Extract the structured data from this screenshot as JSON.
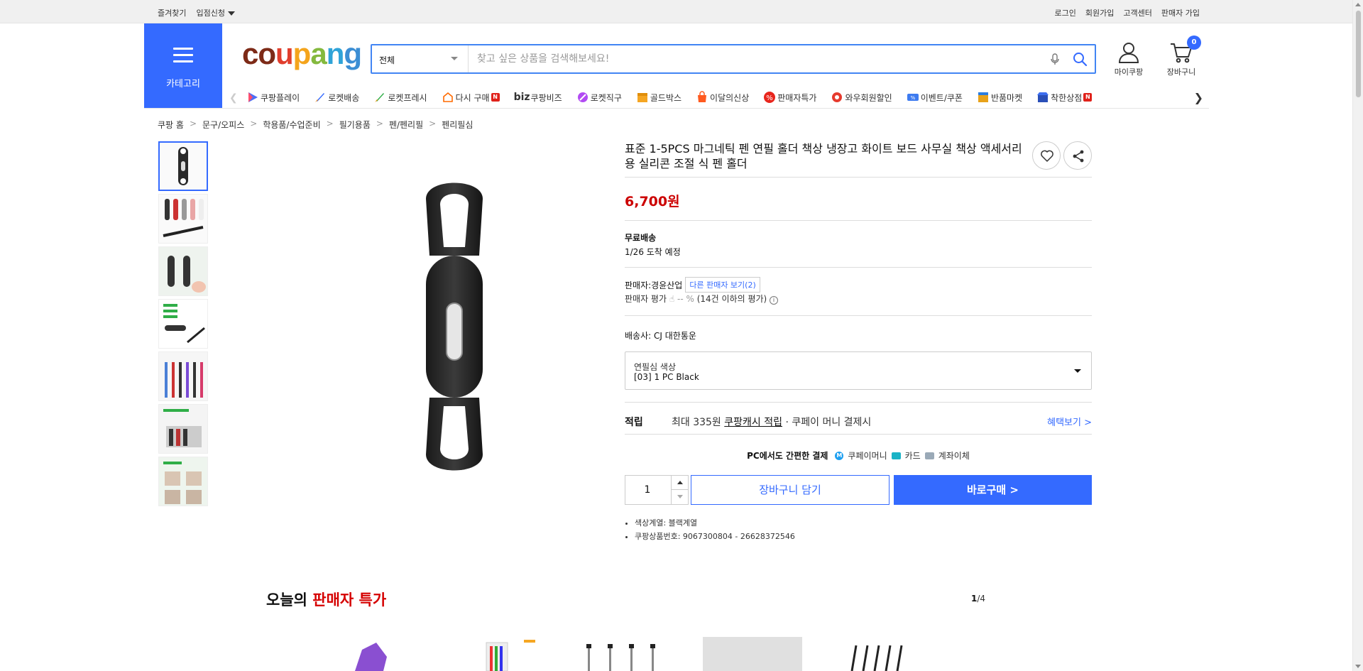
{
  "topbar": {
    "left": [
      "즐겨찾기",
      "입점신청"
    ],
    "right": [
      "로그인",
      "회원가입",
      "고객센터",
      "판매자 가입"
    ]
  },
  "header": {
    "category_label": "카테고리",
    "logo": [
      "c",
      "o",
      "u",
      "p",
      "a",
      "n",
      "g"
    ],
    "search_scope": "전체",
    "search_placeholder": "찾고 싶은 상품을 검색해보세요!",
    "my_label": "마이쿠팡",
    "cart_label": "장바구니",
    "cart_count": "0",
    "brand_color": "#346aff"
  },
  "nav": [
    {
      "label": "쿠팡플레이",
      "icon": "coupang-play-icon"
    },
    {
      "label": "로켓배송",
      "icon": "rocket-icon"
    },
    {
      "label": "로켓프레시",
      "icon": "rocket-fresh-icon"
    },
    {
      "label": "다시 구매",
      "icon": "reorder-icon",
      "badge": "N"
    },
    {
      "label": "쿠팡비즈",
      "icon": "biz-icon",
      "prefix": "biz"
    },
    {
      "label": "로켓직구",
      "icon": "rocket-global-icon"
    },
    {
      "label": "골드박스",
      "icon": "goldbox-icon"
    },
    {
      "label": "이달의신상",
      "icon": "new-arrival-icon"
    },
    {
      "label": "판매자특가",
      "icon": "seller-deal-icon"
    },
    {
      "label": "와우회원할인",
      "icon": "wow-icon"
    },
    {
      "label": "이벤트/쿠폰",
      "icon": "coupon-icon"
    },
    {
      "label": "반품마켓",
      "icon": "return-market-icon"
    },
    {
      "label": "착한상점",
      "icon": "good-shop-icon",
      "badge": "N"
    }
  ],
  "breadcrumb": [
    "쿠팡 홈",
    "문구/오피스",
    "학용품/수업준비",
    "필기용품",
    "펜/펜리필",
    "펜리필심"
  ],
  "product": {
    "title": "표준 1-5PCS 마그네틱 펜 연필 홀더 책상 냉장고 화이트 보드 사무실 책상 액세서리 용 실리콘 조절 식 펜 홀더",
    "price": "6,700원",
    "shipping_title": "무료배송",
    "shipping_eta": "1/26 도착 예정",
    "seller_label": "판매자:",
    "seller_name": "경윤산업",
    "other_sellers": "다른 판매자 보기(2)",
    "rating_label": "판매자 평가",
    "rating_value": "-- %",
    "rating_note": "(14건 이하의 평가)",
    "courier_label": "배송사:",
    "courier_name": "CJ 대한통운",
    "option_label": "연필심 색상",
    "option_value": "[03] 1 PC Black",
    "reward_label": "적립",
    "reward_prefix": "최대 335원",
    "reward_link": "쿠팡캐시 적립",
    "reward_suffix": "· 쿠페이 머니 결제시",
    "benefit_link": "혜택보기 >",
    "pay_title": "PC에서도 간편한 결제",
    "pay_methods": [
      "쿠페이머니",
      "카드",
      "계좌이체"
    ],
    "quantity": "1",
    "add_to_cart": "장바구니 담기",
    "buy_now": "바로구매 >",
    "details": [
      "색상계열: 블랙계열",
      "쿠팡상품번호: 9067300804 - 26628372546"
    ],
    "price_color": "#cc0000"
  },
  "deals": {
    "title_prefix": "오늘의 ",
    "title_highlight": "판매자 특가",
    "page_current": "1",
    "page_total": "/4"
  }
}
